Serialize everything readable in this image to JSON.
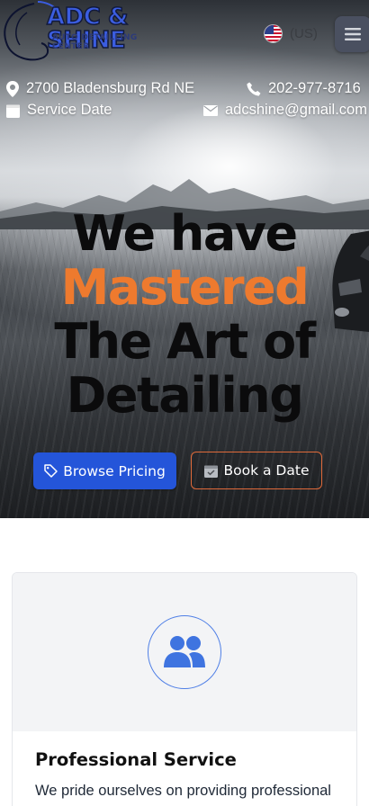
{
  "header": {
    "logo_main": "ADC & SHINE",
    "logo_sub": "AUTO DETAILLING CENTER",
    "language_label": "(US)"
  },
  "contact": {
    "address": "2700 Bladensburg Rd NE",
    "phone": "202-977-8716",
    "service_date": "Service Date",
    "email": "adcshine@gmail.com"
  },
  "hero": {
    "line1": "We have",
    "line2": "Mastered",
    "line3": "The Art of",
    "line4": "Detailing",
    "browse_label": "Browse Pricing",
    "book_label": "Book a Date"
  },
  "feature_card": {
    "title": "Professional Service",
    "text": "We pride ourselves on providing professional"
  },
  "colors": {
    "accent_orange": "#ee7a2e",
    "primary_blue": "#2455d9",
    "icon_blue": "#4f7fe6"
  },
  "icons": {
    "address": "map-pin-icon",
    "phone": "phone-icon",
    "date": "calendar-icon",
    "email": "envelope-icon",
    "menu": "hamburger-icon",
    "browse": "tag-icon",
    "book": "calendar-check-icon",
    "card": "users-icon"
  }
}
